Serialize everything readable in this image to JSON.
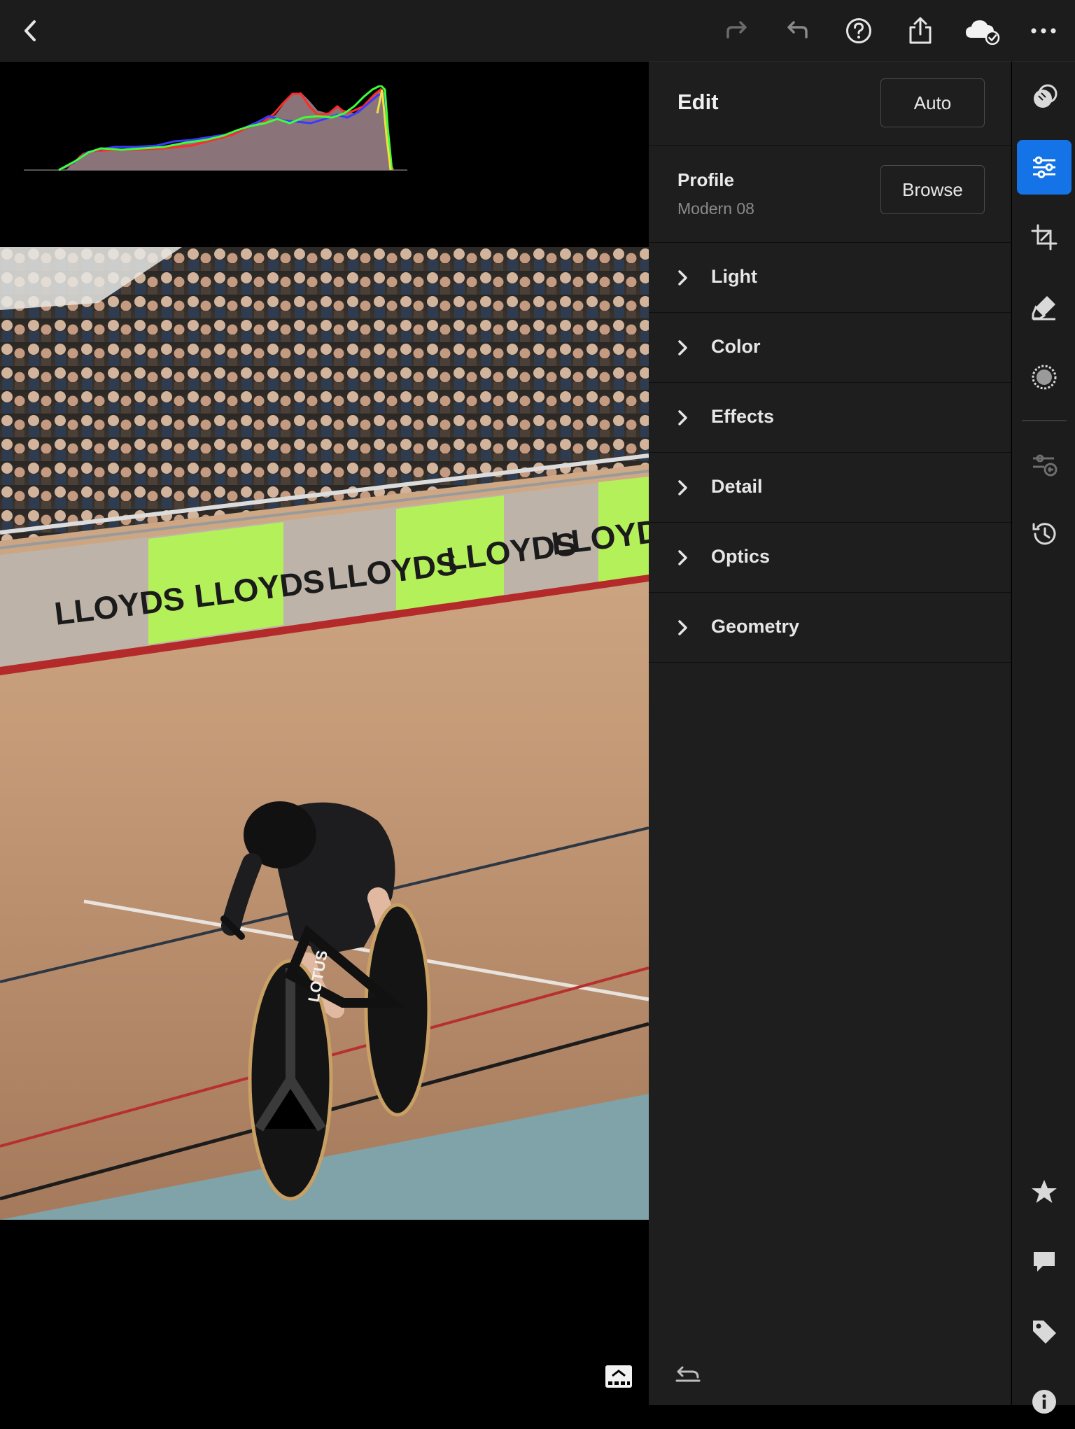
{
  "topbar": {
    "back_icon": "chevron-left-icon",
    "redo_icon": "redo-icon",
    "undo_icon": "undo-icon",
    "help_icon": "help-icon",
    "share_icon": "share-icon",
    "cloud_icon": "cloud-synced-icon",
    "more_icon": "more-icon"
  },
  "histogram": {
    "channels": [
      "red",
      "green",
      "blue"
    ],
    "colors": {
      "red": "#ff2a2a",
      "green": "#3cff3c",
      "blue": "#3a3aff",
      "luma": "#8a7479"
    }
  },
  "photo": {
    "banner_text": "LLOYDS",
    "bike_text": "LOTUS"
  },
  "edit_panel": {
    "title": "Edit",
    "auto_label": "Auto",
    "profile_label": "Profile",
    "profile_value": "Modern 08",
    "browse_label": "Browse",
    "sections": [
      {
        "label": "Light"
      },
      {
        "label": "Color"
      },
      {
        "label": "Effects"
      },
      {
        "label": "Detail"
      },
      {
        "label": "Optics"
      },
      {
        "label": "Geometry"
      }
    ]
  },
  "tool_rail": {
    "items": [
      "presets-icon",
      "edit-sliders-icon",
      "crop-icon",
      "healing-icon",
      "masking-icon",
      "versions-icon",
      "history-icon",
      "rating-icon",
      "comments-icon",
      "keywords-icon",
      "info-icon"
    ],
    "active": "edit-sliders-icon",
    "accent": "#1473e6"
  }
}
